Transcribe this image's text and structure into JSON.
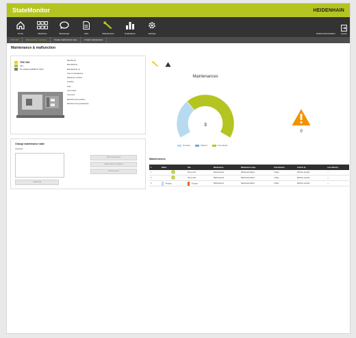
{
  "app": {
    "title": "StateMonitor",
    "brand": "HEIDENHAIN",
    "accent_color": "#b4c421"
  },
  "nav": {
    "items": [
      {
        "label": "Home",
        "icon": "home-icon"
      },
      {
        "label": "Machines",
        "icon": "grid-icon"
      },
      {
        "label": "Messenger",
        "icon": "chat-icon"
      },
      {
        "label": "Jobs",
        "icon": "document-icon"
      },
      {
        "label": "Maintenance",
        "icon": "wrench-icon",
        "active": true
      },
      {
        "label": "Evaluations",
        "icon": "bar-chart-icon"
      },
      {
        "label": "Settings",
        "icon": "gear-icon"
      }
    ],
    "user": "Default Administrator",
    "logout": "Logout"
  },
  "tabs": [
    {
      "label": "TNC 640"
    },
    {
      "label": "Maintenance overview",
      "active": true
    },
    {
      "label": "Create maintenance step"
    },
    {
      "label": "Create maintenance"
    }
  ],
  "page_title": "Maintenance & malfunction",
  "machine": {
    "name": "TNC 640",
    "status": "SIK |",
    "software": "NC software:340590 07 SP2C",
    "status_colors": [
      "#f2cf00",
      "#b4c421",
      "#777777"
    ],
    "fields": [
      "Machine ID",
      "Manufacturer",
      "Manufacturer no.",
      "Year of manufacture",
      "Equipment number",
      "Location",
      "Area",
      "Cost center",
      "Comment",
      "Machine hours (online)",
      "Machine hours (productive)"
    ]
  },
  "change_state": {
    "title": "Change maintenance state",
    "comment_label": "Comment",
    "buttons": [
      "Start maintenance",
      "Maintenance completed",
      "No documents"
    ],
    "upload_label": "Upload log"
  },
  "donut": {
    "title": "Maintenances",
    "total": "3",
    "segments": [
      {
        "name": "Pending",
        "value": 1,
        "color": "#b7daf0"
      },
      {
        "name": "Started",
        "value": 0,
        "color": "#6fa6d8"
      },
      {
        "name": "Completed",
        "value": 2,
        "color": "#b4c421"
      }
    ]
  },
  "warning": {
    "count": "0",
    "color": "#f39200"
  },
  "legend": [
    {
      "label": "Pending",
      "color": "#b7daf0"
    },
    {
      "label": "Started",
      "color": "#6fa6d8"
    },
    {
      "label": "Completed",
      "color": "#b4c421"
    }
  ],
  "table": {
    "title": "Maintenances",
    "headers": [
      "#",
      "Status",
      "Due",
      "Maintenance",
      "Maintenance steps",
      "Total duration",
      "Perform by",
      "Last edited by"
    ],
    "rows": [
      {
        "n": "1",
        "status": "",
        "status_type": "check",
        "due": "Not yet due",
        "due_color": "",
        "maint": "Maintenance2",
        "steps": "MaintenanceStep1",
        "duration": "2 Days",
        "by": "Machine operator",
        "edited": "—"
      },
      {
        "n": "2",
        "status": "",
        "status_type": "check",
        "due": "Not yet due",
        "due_color": "",
        "maint": "Maintenance3",
        "steps": "MaintenanceStep1",
        "duration": "2 Days",
        "by": "Machine operator",
        "edited": "—"
      },
      {
        "n": "3",
        "status": "Pending",
        "status_type": "pending",
        "due": "Overdue",
        "due_color": "#e2671e",
        "maint": "Maintenance1",
        "steps": "MaintenanceStep1",
        "duration": "2 Days",
        "by": "Machine operator",
        "edited": "—"
      }
    ]
  }
}
